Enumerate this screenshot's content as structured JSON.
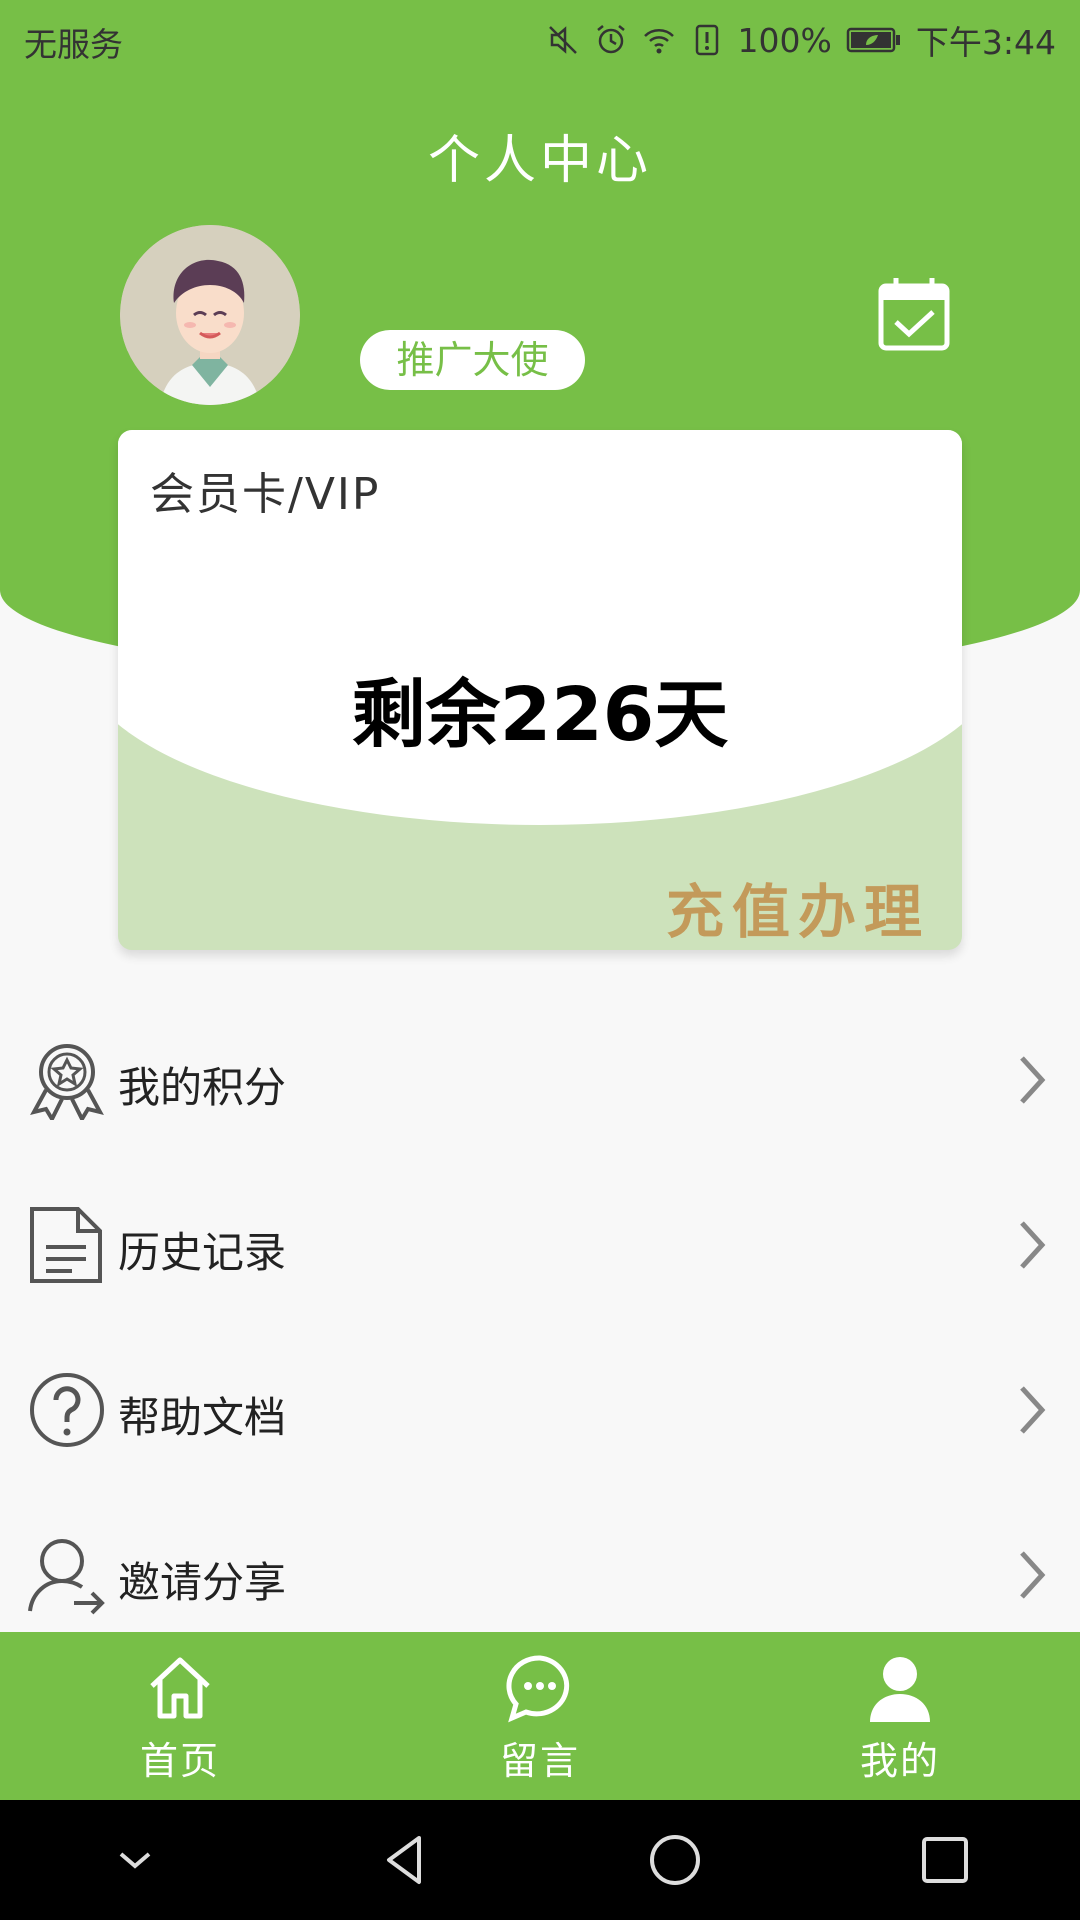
{
  "status_bar": {
    "carrier": "无服务",
    "battery": "100%",
    "time": "下午3:44"
  },
  "header": {
    "title": "个人中心",
    "badge": "推广大使"
  },
  "card": {
    "label": "会员卡/VIP",
    "days_remaining": "剩余226天",
    "action": "充值办理"
  },
  "menu": [
    {
      "label": "我的积分",
      "icon": "award-star-icon"
    },
    {
      "label": "历史记录",
      "icon": "document-icon"
    },
    {
      "label": "帮助文档",
      "icon": "help-circle-icon"
    },
    {
      "label": "邀请分享",
      "icon": "user-share-icon"
    }
  ],
  "bottom_nav": [
    {
      "label": "首页",
      "icon": "home-icon"
    },
    {
      "label": "留言",
      "icon": "chat-icon"
    },
    {
      "label": "我的",
      "icon": "user-icon"
    }
  ],
  "colors": {
    "primary": "#77bf47",
    "card_bottom": "#cde2bb",
    "accent_gold": "#c39a5a"
  }
}
